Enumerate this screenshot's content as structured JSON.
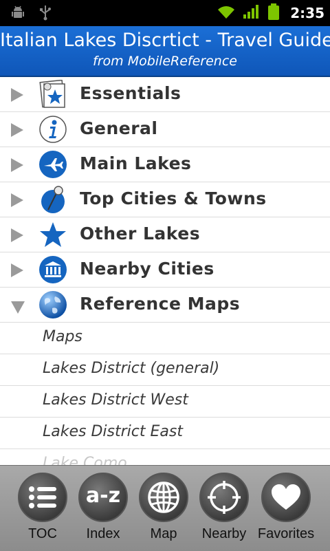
{
  "status_bar": {
    "time": "2:35"
  },
  "header": {
    "title": "Italian Lakes Discrtict - Travel Guide",
    "subtitle": "from MobileReference"
  },
  "menu": [
    {
      "label": "Essentials",
      "icon": "essentials-icon",
      "expanded": false
    },
    {
      "label": "General",
      "icon": "info-icon",
      "expanded": false
    },
    {
      "label": "Main Lakes",
      "icon": "airplane-icon",
      "expanded": false
    },
    {
      "label": "Top Cities & Towns",
      "icon": "pushpin-icon",
      "expanded": false
    },
    {
      "label": "Other Lakes",
      "icon": "star-icon",
      "expanded": false
    },
    {
      "label": "Nearby Cities",
      "icon": "museum-icon",
      "expanded": false
    },
    {
      "label": "Reference Maps",
      "icon": "globe-icon",
      "expanded": true
    }
  ],
  "submenu": [
    {
      "label": "Maps"
    },
    {
      "label": "Lakes District (general)"
    },
    {
      "label": "Lakes District West"
    },
    {
      "label": "Lakes District East"
    },
    {
      "label": "Lake Como"
    }
  ],
  "toolbar": {
    "toc": "TOC",
    "index": "Index",
    "index_icon_text": "a-z",
    "map": "Map",
    "nearby": "Nearby",
    "favorites": "Favorites"
  },
  "colors": {
    "header_blue": "#1b6fd6",
    "icon_blue": "#1565c0",
    "toolbar_gray": "#9b9b9b"
  }
}
